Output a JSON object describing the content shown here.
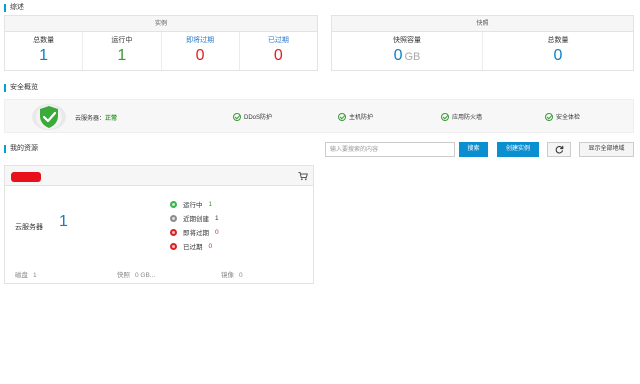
{
  "overview": {
    "title": "综述",
    "instances": {
      "title": "实例",
      "stats": [
        {
          "label": "总数量",
          "value": "1"
        },
        {
          "label": "运行中",
          "value": "1"
        },
        {
          "label": "即将过期",
          "value": "0"
        },
        {
          "label": "已过期",
          "value": "0"
        }
      ]
    },
    "snapshots": {
      "title": "快照",
      "stats": [
        {
          "label": "快照容量",
          "value": "0",
          "unit": "GB"
        },
        {
          "label": "总数量",
          "value": "0"
        }
      ]
    }
  },
  "security": {
    "title": "安全概览",
    "server_label": "云服务器：",
    "server_status": "正常",
    "items": [
      "DDoS防护",
      "主机防护",
      "应用防火墙",
      "安全体检"
    ]
  },
  "resources": {
    "title": "我的资源",
    "search_placeholder": "输入要搜索的内容",
    "search_button": "搜索",
    "create_button": "创建实例",
    "show_all_button": "显示全部地域",
    "card": {
      "name": "云服务器",
      "count": "1",
      "statuses": [
        {
          "label": "运行中",
          "value": "1",
          "color": "#39b54a"
        },
        {
          "label": "近期创建",
          "value": "1",
          "color": "#8c8c8c"
        },
        {
          "label": "即将过期",
          "value": "0",
          "color": "#e02020"
        },
        {
          "label": "已过期",
          "value": "0",
          "color": "#e02020"
        }
      ],
      "footer": [
        {
          "label": "磁盘",
          "value": "1"
        },
        {
          "label": "快照",
          "value": "0 GB..."
        },
        {
          "label": "镜像",
          "value": "0"
        }
      ]
    }
  },
  "colors": {
    "accent": "#0a8fd0",
    "success": "#3a9b35",
    "danger": "#e02020",
    "redacted": "#e8101a"
  }
}
